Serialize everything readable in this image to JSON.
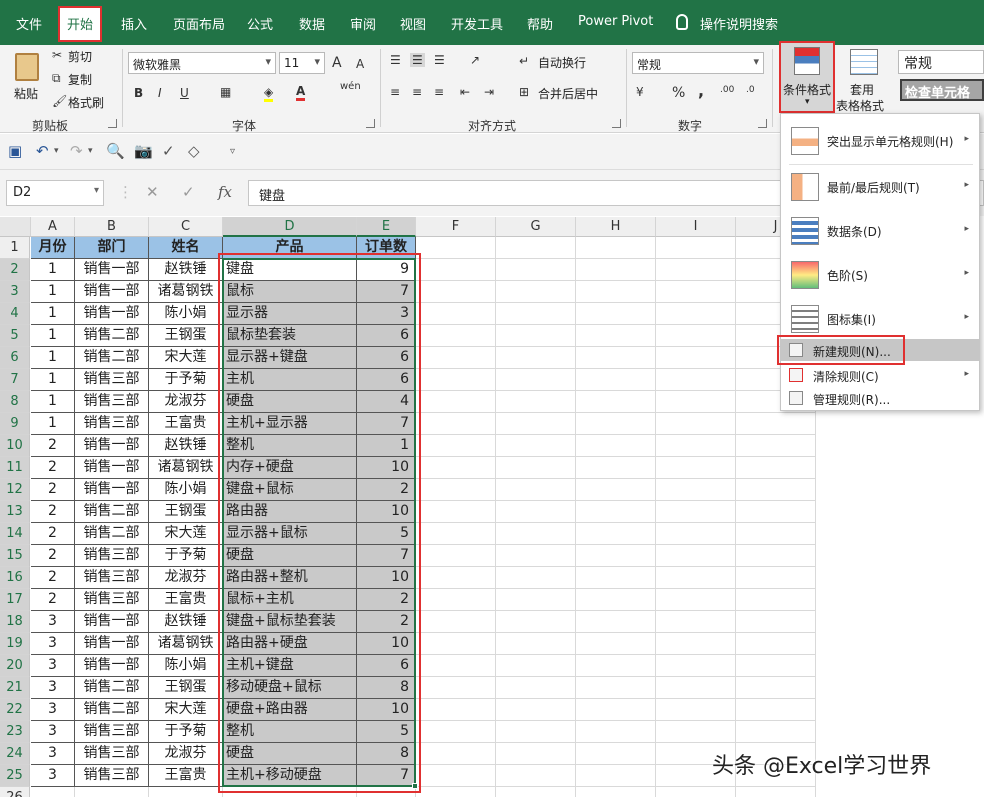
{
  "tabs": [
    "文件",
    "开始",
    "插入",
    "页面布局",
    "公式",
    "数据",
    "审阅",
    "视图",
    "开发工具",
    "帮助",
    "Power Pivot",
    "操作说明搜索"
  ],
  "ribbon": {
    "clipboard": {
      "paste": "粘贴",
      "cut": "剪切",
      "copy": "复制",
      "format_painter": "格式刷",
      "label": "剪贴板"
    },
    "font": {
      "name": "微软雅黑",
      "size": "11",
      "grow": "A",
      "shrink": "A",
      "bold": "B",
      "italic": "I",
      "underline": "U",
      "wen": "wén",
      "label": "字体"
    },
    "align": {
      "wrap": "自动换行",
      "merge": "合并后居中",
      "label": "对齐方式"
    },
    "number": {
      "format": "常规",
      "percent": "%",
      "comma": ",",
      "label": "数字"
    },
    "styles": {
      "conditional": "条件格式",
      "table_line1": "套用",
      "table_line2": "表格格式",
      "style_normal": "常规",
      "style_check": "检查单元格"
    }
  },
  "namebox": "D2",
  "formula": "键盘",
  "fx": "fx",
  "columns": [
    "A",
    "B",
    "C",
    "D",
    "E",
    "F",
    "G",
    "H",
    "I",
    "J"
  ],
  "headers": [
    "月份",
    "部门",
    "姓名",
    "产品",
    "订单数"
  ],
  "rows": [
    [
      "1",
      "销售一部",
      "赵铁锤",
      "键盘",
      "9"
    ],
    [
      "1",
      "销售一部",
      "诸葛钢铁",
      "鼠标",
      "7"
    ],
    [
      "1",
      "销售一部",
      "陈小娟",
      "显示器",
      "3"
    ],
    [
      "1",
      "销售二部",
      "王钢蛋",
      "鼠标垫套装",
      "6"
    ],
    [
      "1",
      "销售二部",
      "宋大莲",
      "显示器+键盘",
      "6"
    ],
    [
      "1",
      "销售三部",
      "于予菊",
      "主机",
      "6"
    ],
    [
      "1",
      "销售三部",
      "龙淑芬",
      "硬盘",
      "4"
    ],
    [
      "1",
      "销售三部",
      "王富贵",
      "主机+显示器",
      "7"
    ],
    [
      "2",
      "销售一部",
      "赵铁锤",
      "整机",
      "1"
    ],
    [
      "2",
      "销售一部",
      "诸葛钢铁",
      "内存+硬盘",
      "10"
    ],
    [
      "2",
      "销售一部",
      "陈小娟",
      "键盘+鼠标",
      "2"
    ],
    [
      "2",
      "销售二部",
      "王钢蛋",
      "路由器",
      "10"
    ],
    [
      "2",
      "销售二部",
      "宋大莲",
      "显示器+鼠标",
      "5"
    ],
    [
      "2",
      "销售三部",
      "于予菊",
      "硬盘",
      "7"
    ],
    [
      "2",
      "销售三部",
      "龙淑芬",
      "路由器+整机",
      "10"
    ],
    [
      "2",
      "销售三部",
      "王富贵",
      "鼠标+主机",
      "2"
    ],
    [
      "3",
      "销售一部",
      "赵铁锤",
      "键盘+鼠标垫套装",
      "2"
    ],
    [
      "3",
      "销售一部",
      "诸葛钢铁",
      "路由器+硬盘",
      "10"
    ],
    [
      "3",
      "销售一部",
      "陈小娟",
      "主机+键盘",
      "6"
    ],
    [
      "3",
      "销售二部",
      "王钢蛋",
      "移动硬盘+鼠标",
      "8"
    ],
    [
      "3",
      "销售二部",
      "宋大莲",
      "硬盘+路由器",
      "10"
    ],
    [
      "3",
      "销售三部",
      "于予菊",
      "整机",
      "5"
    ],
    [
      "3",
      "销售三部",
      "龙淑芬",
      "硬盘",
      "8"
    ],
    [
      "3",
      "销售三部",
      "王富贵",
      "主机+移动硬盘",
      "7"
    ]
  ],
  "menu": {
    "highlight": "突出显示单元格规则(H)",
    "topbottom": "最前/最后规则(T)",
    "databar": "数据条(D)",
    "colorscale": "色阶(S)",
    "iconset": "图标集(I)",
    "newrule": "新建规则(N)...",
    "clearrule": "清除规则(C)",
    "managerule": "管理规则(R)..."
  },
  "watermark": "头条 @Excel学习世界",
  "colors": {
    "ribbon_green": "#217346",
    "header_fill": "#9bc2e6",
    "selected_fill": "#c9c9c9",
    "red_outline": "#e03030"
  }
}
